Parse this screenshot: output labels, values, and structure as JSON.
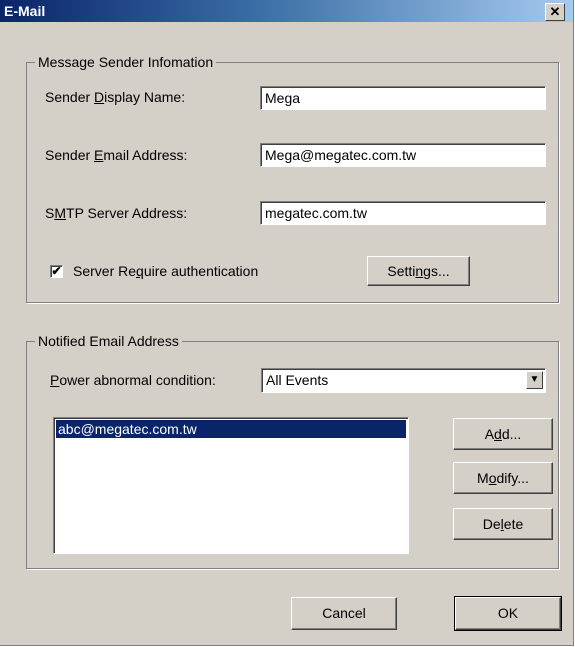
{
  "window": {
    "title": "E-Mail",
    "close_glyph": "✕"
  },
  "sender": {
    "group_label": "Message Sender Infomation",
    "display_name": {
      "pre": "Sender ",
      "accel": "D",
      "post": "isplay Name:",
      "value": "Mega"
    },
    "email_address": {
      "pre": "Sender ",
      "accel": "E",
      "post": "mail Address:",
      "value": "Mega@megatec.com.tw"
    },
    "smtp_address": {
      "pre": "S",
      "accel": "M",
      "post": "TP Server Address:",
      "value": "megatec.com.tw"
    },
    "auth": {
      "pre": "Server Re",
      "accel": "q",
      "post": "uire authentication",
      "checked": true,
      "check_glyph": "✔"
    },
    "settings_button": {
      "pre": "Setti",
      "accel": "n",
      "post": "gs..."
    }
  },
  "notified": {
    "group_label": "Notified Email Address",
    "condition": {
      "accel": "P",
      "post": "ower abnormal condition:",
      "selected": "All Events",
      "arrow_glyph": "▼"
    },
    "emails": [
      {
        "address": "abc@megatec.com.tw",
        "selected": true
      }
    ],
    "add_button": {
      "pre": "A",
      "accel": "d",
      "post": "d..."
    },
    "modify_button": {
      "pre": "M",
      "accel": "o",
      "post": "dify..."
    },
    "delete_button": {
      "pre": "De",
      "accel": "l",
      "post": "ete"
    }
  },
  "footer": {
    "cancel_label": "Cancel",
    "ok_label": "OK"
  }
}
